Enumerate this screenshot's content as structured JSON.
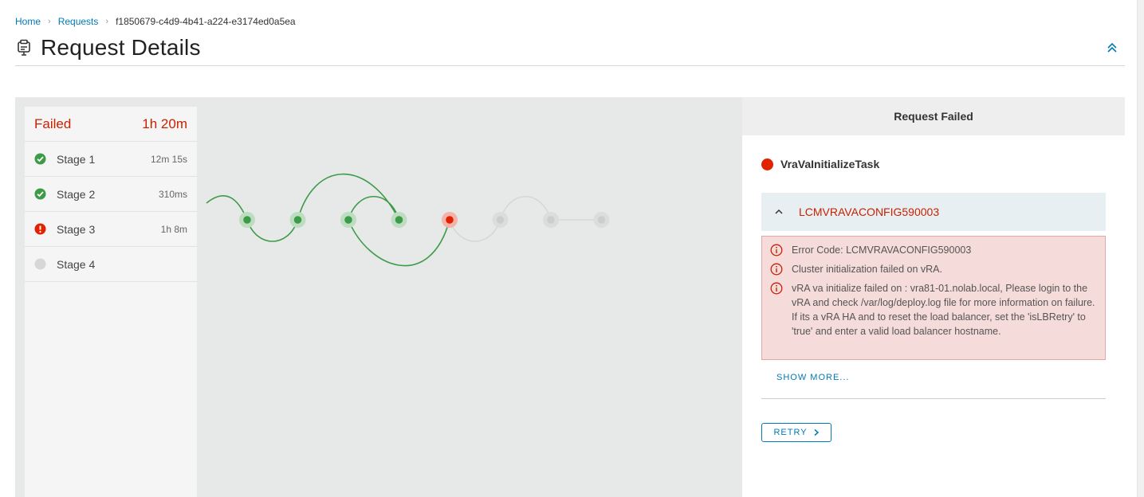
{
  "breadcrumb": {
    "home": "Home",
    "requests": "Requests",
    "current": "f1850679-c4d9-4b41-a224-e3174ed0a5ea"
  },
  "page": {
    "title": "Request Details",
    "title_icon": "request-icon",
    "collapse_icon": "double-chevron-up-icon"
  },
  "stages": {
    "status": "Failed",
    "total_duration": "1h 20m",
    "items": [
      {
        "name": "Stage 1",
        "duration": "12m 15s",
        "status": "success"
      },
      {
        "name": "Stage 2",
        "duration": "310ms",
        "status": "success"
      },
      {
        "name": "Stage 3",
        "duration": "1h 8m",
        "status": "error"
      },
      {
        "name": "Stage 4",
        "duration": "",
        "status": "pending"
      }
    ]
  },
  "flow": {
    "nodes": [
      {
        "status": "success"
      },
      {
        "status": "success"
      },
      {
        "status": "success"
      },
      {
        "status": "success"
      },
      {
        "status": "error"
      },
      {
        "status": "pending"
      },
      {
        "status": "pending"
      },
      {
        "status": "pending"
      }
    ]
  },
  "details": {
    "header": "Request Failed",
    "task_name": "VraVaInitializeTask",
    "error_code_title": "LCMVRAVACONFIG590003",
    "errors": [
      "Error Code: LCMVRAVACONFIG590003",
      "Cluster initialization failed on vRA.",
      "vRA va initialize failed on : vra81-01.nolab.local, Please login to the vRA and check /var/log/deploy.log file for more information on failure. If its a vRA HA and to reset the load balancer, set the 'isLBRetry' to 'true' and enter a valid load balancer hostname."
    ],
    "show_more": "SHOW MORE...",
    "retry_label": "RETRY"
  },
  "colors": {
    "success": "#3d9b47",
    "error": "#e12200",
    "pending": "#d7d7d7",
    "link": "#0079b8"
  }
}
